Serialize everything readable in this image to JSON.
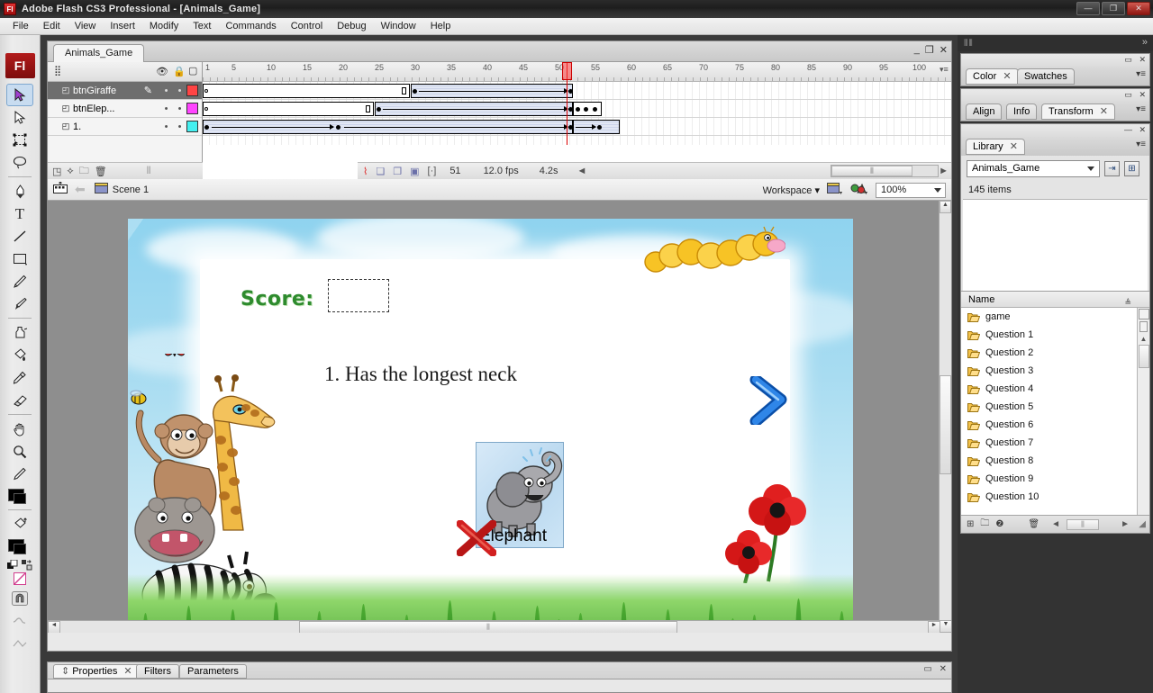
{
  "window": {
    "app_icon": "Fl",
    "title": "Adobe Flash CS3 Professional - [Animals_Game]",
    "minimize": "—",
    "maximize": "❐",
    "close": "✕"
  },
  "menubar": {
    "items": [
      "File",
      "Edit",
      "View",
      "Insert",
      "Modify",
      "Text",
      "Commands",
      "Control",
      "Debug",
      "Window",
      "Help"
    ]
  },
  "tools": {
    "logo": "Fl",
    "items": [
      {
        "name": "selection-tool",
        "glyph": "selection",
        "selected": true
      },
      {
        "name": "subselection-tool",
        "glyph": "subselect",
        "selected": false
      },
      {
        "name": "free-transform-tool",
        "glyph": "transform",
        "selected": false
      },
      {
        "name": "lasso-tool",
        "glyph": "lasso",
        "selected": false
      },
      {
        "name": "pen-tool",
        "glyph": "pen",
        "selected": false
      },
      {
        "name": "text-tool",
        "glyph": "T",
        "selected": false
      },
      {
        "name": "line-tool",
        "glyph": "line",
        "selected": false
      },
      {
        "name": "rectangle-tool",
        "glyph": "rect",
        "selected": false
      },
      {
        "name": "pencil-tool",
        "glyph": "pencil",
        "selected": false
      },
      {
        "name": "brush-tool",
        "glyph": "brush",
        "selected": false
      },
      {
        "name": "ink-bottle-tool",
        "glyph": "inkbottle",
        "selected": false
      },
      {
        "name": "paint-bucket-tool",
        "glyph": "bucket",
        "selected": false
      },
      {
        "name": "eyedropper-tool",
        "glyph": "eyedropper",
        "selected": false
      },
      {
        "name": "eraser-tool",
        "glyph": "eraser",
        "selected": false
      },
      {
        "name": "hand-tool",
        "glyph": "hand",
        "selected": false
      },
      {
        "name": "zoom-tool",
        "glyph": "magnifier",
        "selected": false
      }
    ]
  },
  "document": {
    "tab_label": "Animals_Game",
    "minimize": "_",
    "restore": "❐",
    "close": "✕"
  },
  "timeline": {
    "header_icons": {
      "eye": "eye-icon",
      "lock": "lock-icon",
      "outline": "outline-icon"
    },
    "ruler_ticks": [
      "1",
      "5",
      "10",
      "15",
      "20",
      "25",
      "30",
      "35",
      "40",
      "45",
      "50",
      "55",
      "60",
      "65",
      "70",
      "75",
      "80",
      "85",
      "90",
      "95",
      "100"
    ],
    "playhead_frame": 51,
    "layers": [
      {
        "name": "btnGiraffe",
        "color": "#ff4444",
        "selected": true,
        "pencil": "pencil-icon"
      },
      {
        "name": "btnElep...",
        "color": "#ff44ff",
        "selected": false,
        "pencil": ""
      },
      {
        "name": "1.",
        "color": "#44f0f0",
        "selected": false,
        "pencil": ""
      }
    ],
    "layer_tools": [
      "new-layer-icon",
      "add-motion-guide-icon",
      "new-folder-icon",
      "delete-layer-icon"
    ],
    "status": {
      "onion_icons": [
        "center-frame-icon",
        "onion-skin-icon",
        "onion-skin-outlines-icon",
        "edit-multiple-frames-icon",
        "modify-onion-markers-icon"
      ],
      "current_frame": "51",
      "fps": "12.0 fps",
      "elapsed": "4.2s"
    }
  },
  "editbar": {
    "timeline_toggle": "timeline-icon",
    "back_arrow": "back-arrow-icon",
    "scene_icon": "scene-icon",
    "scene_label": "Scene 1",
    "workspace_label": "Workspace",
    "edit_scene_icon": "edit-scene-icon",
    "edit_symbols_icon": "edit-symbols-icon",
    "zoom_value": "100%"
  },
  "stage": {
    "score_label": "Score:",
    "score_value": "",
    "question_text": "1. Has the longest neck",
    "answer_label": "Elephant",
    "next_arrow": "next-arrow-icon",
    "wrong_mark": "red-x-icon",
    "colors": {
      "score_green": "#2e8b2e",
      "sky_blue": "#8fd3ef",
      "grass_green": "#3f9c2c",
      "arrow_blue": "#1a5fc8",
      "x_red": "#cc2020"
    }
  },
  "properties_panel": {
    "tabs": [
      "Properties",
      "Filters",
      "Parameters"
    ],
    "active_tab": "Properties",
    "close": "✕",
    "collapse": "▭",
    "panel_close": "✕"
  },
  "right_dock": {
    "expand_icon": "expand-dock-icon",
    "groups": [
      {
        "name": "color-swatches-group",
        "tabs": [
          "Color",
          "Swatches"
        ],
        "active_tab": "Color",
        "collapse": "▭",
        "close": "✕",
        "menu": "panel-menu-icon"
      },
      {
        "name": "align-info-transform-group",
        "tabs": [
          "Align",
          "Info",
          "Transform"
        ],
        "active_tab": "Transform",
        "collapse": "▭",
        "close": "✕",
        "menu": "panel-menu-icon"
      }
    ],
    "library": {
      "tab": "Library",
      "collapse": "—",
      "close": "✕",
      "menu": "panel-menu-icon",
      "document_select": "Animals_Game",
      "pin_icon": "pin-icon",
      "new_library_icon": "new-library-panel-icon",
      "item_count": "145 items",
      "column_header": "Name",
      "items": [
        {
          "label": "game",
          "icon": "folder-icon"
        },
        {
          "label": "Question 1",
          "icon": "folder-icon"
        },
        {
          "label": "Question 2",
          "icon": "folder-icon"
        },
        {
          "label": "Question 3",
          "icon": "folder-icon"
        },
        {
          "label": "Question 4",
          "icon": "folder-icon"
        },
        {
          "label": "Question 5",
          "icon": "folder-icon"
        },
        {
          "label": "Question 6",
          "icon": "folder-icon"
        },
        {
          "label": "Question 7",
          "icon": "folder-icon"
        },
        {
          "label": "Question 8",
          "icon": "folder-icon"
        },
        {
          "label": "Question 9",
          "icon": "folder-icon"
        },
        {
          "label": "Question 10",
          "icon": "folder-icon"
        }
      ],
      "bottom_tools": [
        "new-symbol-icon",
        "new-folder-icon",
        "properties-icon",
        "delete-icon"
      ]
    }
  }
}
